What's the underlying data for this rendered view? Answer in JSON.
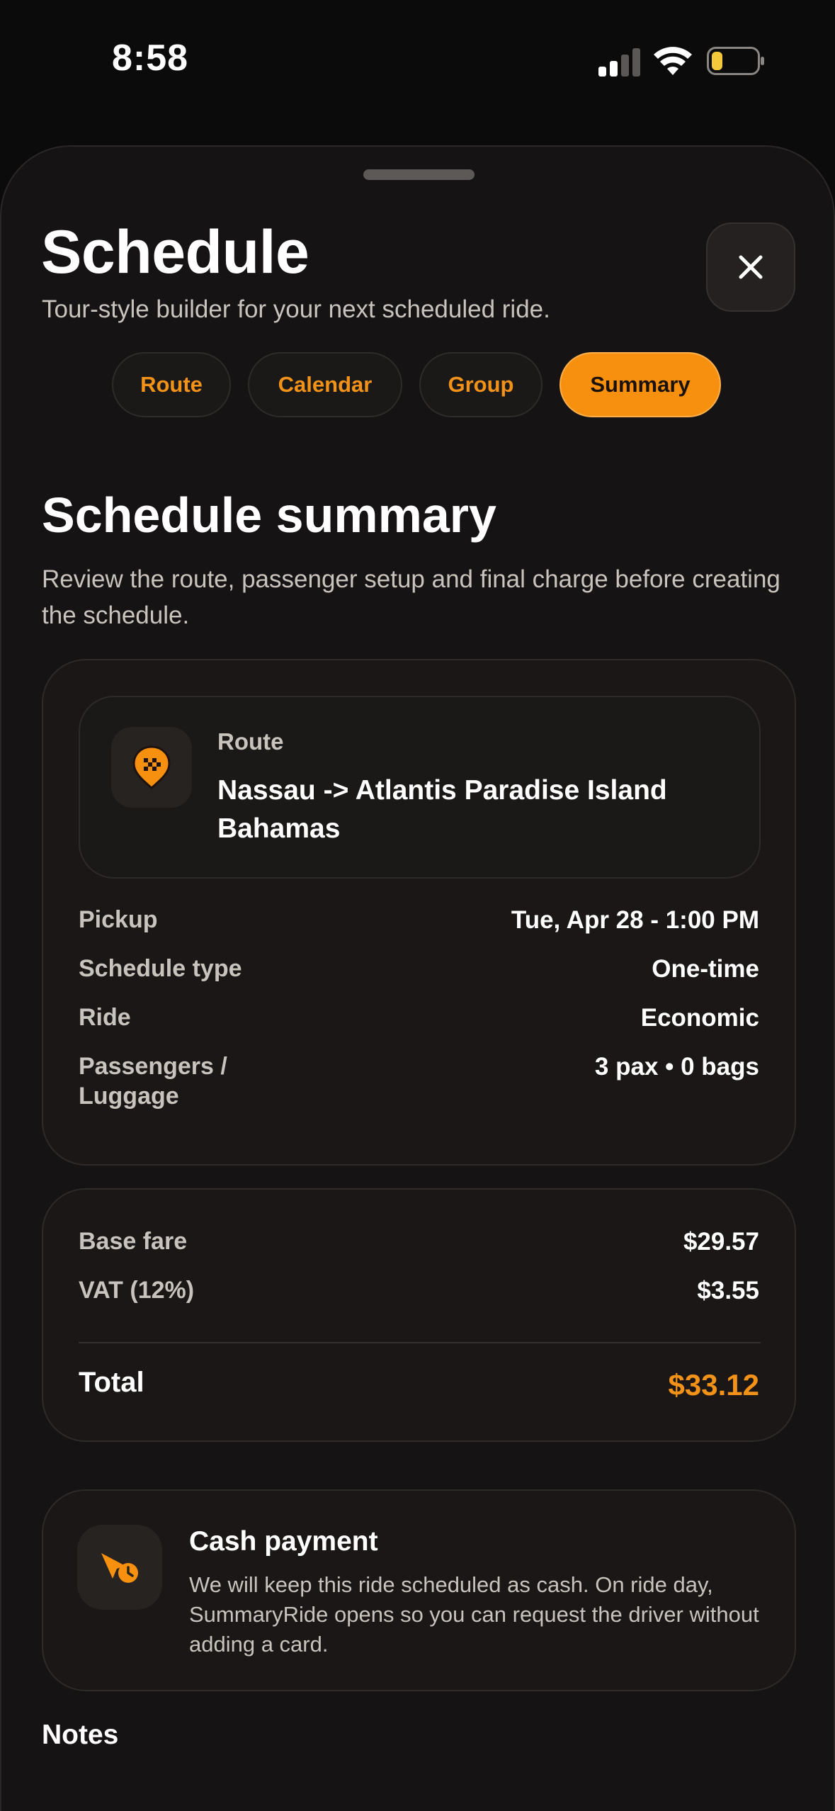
{
  "status_bar": {
    "time": "8:58",
    "signal_icon": "cellular-signal-icon",
    "wifi_icon": "wifi-icon",
    "battery_icon": "battery-low-icon",
    "battery_color": "#f3c83b"
  },
  "sheet": {
    "title": "Schedule",
    "subtitle": "Tour-style builder for your next scheduled ride.",
    "close_icon": "close-icon"
  },
  "tabs": [
    {
      "label": "Route",
      "active": false
    },
    {
      "label": "Calendar",
      "active": false
    },
    {
      "label": "Group",
      "active": false
    },
    {
      "label": "Summary",
      "active": true
    }
  ],
  "summary": {
    "title": "Schedule summary",
    "description": "Review the route, passenger setup and final charge before creating the schedule."
  },
  "route": {
    "icon": "taxi-pin-icon",
    "label": "Route",
    "value": "Nassau -> Atlantis Paradise Island Bahamas"
  },
  "details": [
    {
      "label": "Pickup",
      "value": "Tue, Apr 28 - 1:00 PM"
    },
    {
      "label": "Schedule type",
      "value": "One-time"
    },
    {
      "label": "Ride",
      "value": "Economic"
    },
    {
      "label": "Passengers / Luggage",
      "value": "3 pax • 0 bags"
    }
  ],
  "fare": {
    "base_label": "Base fare",
    "base_value": "$29.57",
    "vat_label": "VAT (12%)",
    "vat_value": "$3.55",
    "total_label": "Total",
    "total_value": "$33.12"
  },
  "payment": {
    "icon": "scheduled-ride-icon",
    "title": "Cash payment",
    "description": "We will keep this ride scheduled as cash. On ride day, SummaryRide opens so you can request the driver without adding a card."
  },
  "notes": {
    "title": "Notes"
  },
  "colors": {
    "accent": "#f7900f",
    "background": "#0c0b0b",
    "card": "#1a1716"
  }
}
